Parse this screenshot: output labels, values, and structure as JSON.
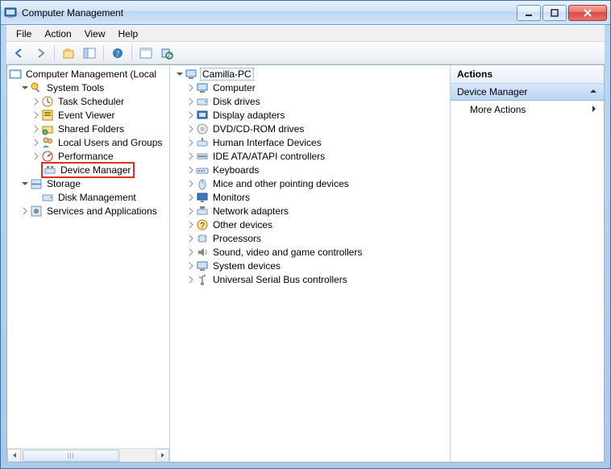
{
  "window": {
    "title": "Computer Management"
  },
  "menu": {
    "file": "File",
    "action": "Action",
    "view": "View",
    "help": "Help"
  },
  "left_tree": {
    "root": "Computer Management (Local",
    "system_tools": "System Tools",
    "task_scheduler": "Task Scheduler",
    "event_viewer": "Event Viewer",
    "shared_folders": "Shared Folders",
    "local_users": "Local Users and Groups",
    "performance": "Performance",
    "device_manager": "Device Manager",
    "storage": "Storage",
    "disk_management": "Disk Management",
    "services_apps": "Services and Applications"
  },
  "center_tree": {
    "root": "Camilla-PC",
    "computer": "Computer",
    "disk_drives": "Disk drives",
    "display_adapters": "Display adapters",
    "dvd": "DVD/CD-ROM drives",
    "hid": "Human Interface Devices",
    "ide": "IDE ATA/ATAPI controllers",
    "keyboards": "Keyboards",
    "mice": "Mice and other pointing devices",
    "monitors": "Monitors",
    "network": "Network adapters",
    "other": "Other devices",
    "processors": "Processors",
    "sound": "Sound, video and game controllers",
    "system": "System devices",
    "usb": "Universal Serial Bus controllers"
  },
  "actions": {
    "header": "Actions",
    "context": "Device Manager",
    "more": "More Actions"
  }
}
